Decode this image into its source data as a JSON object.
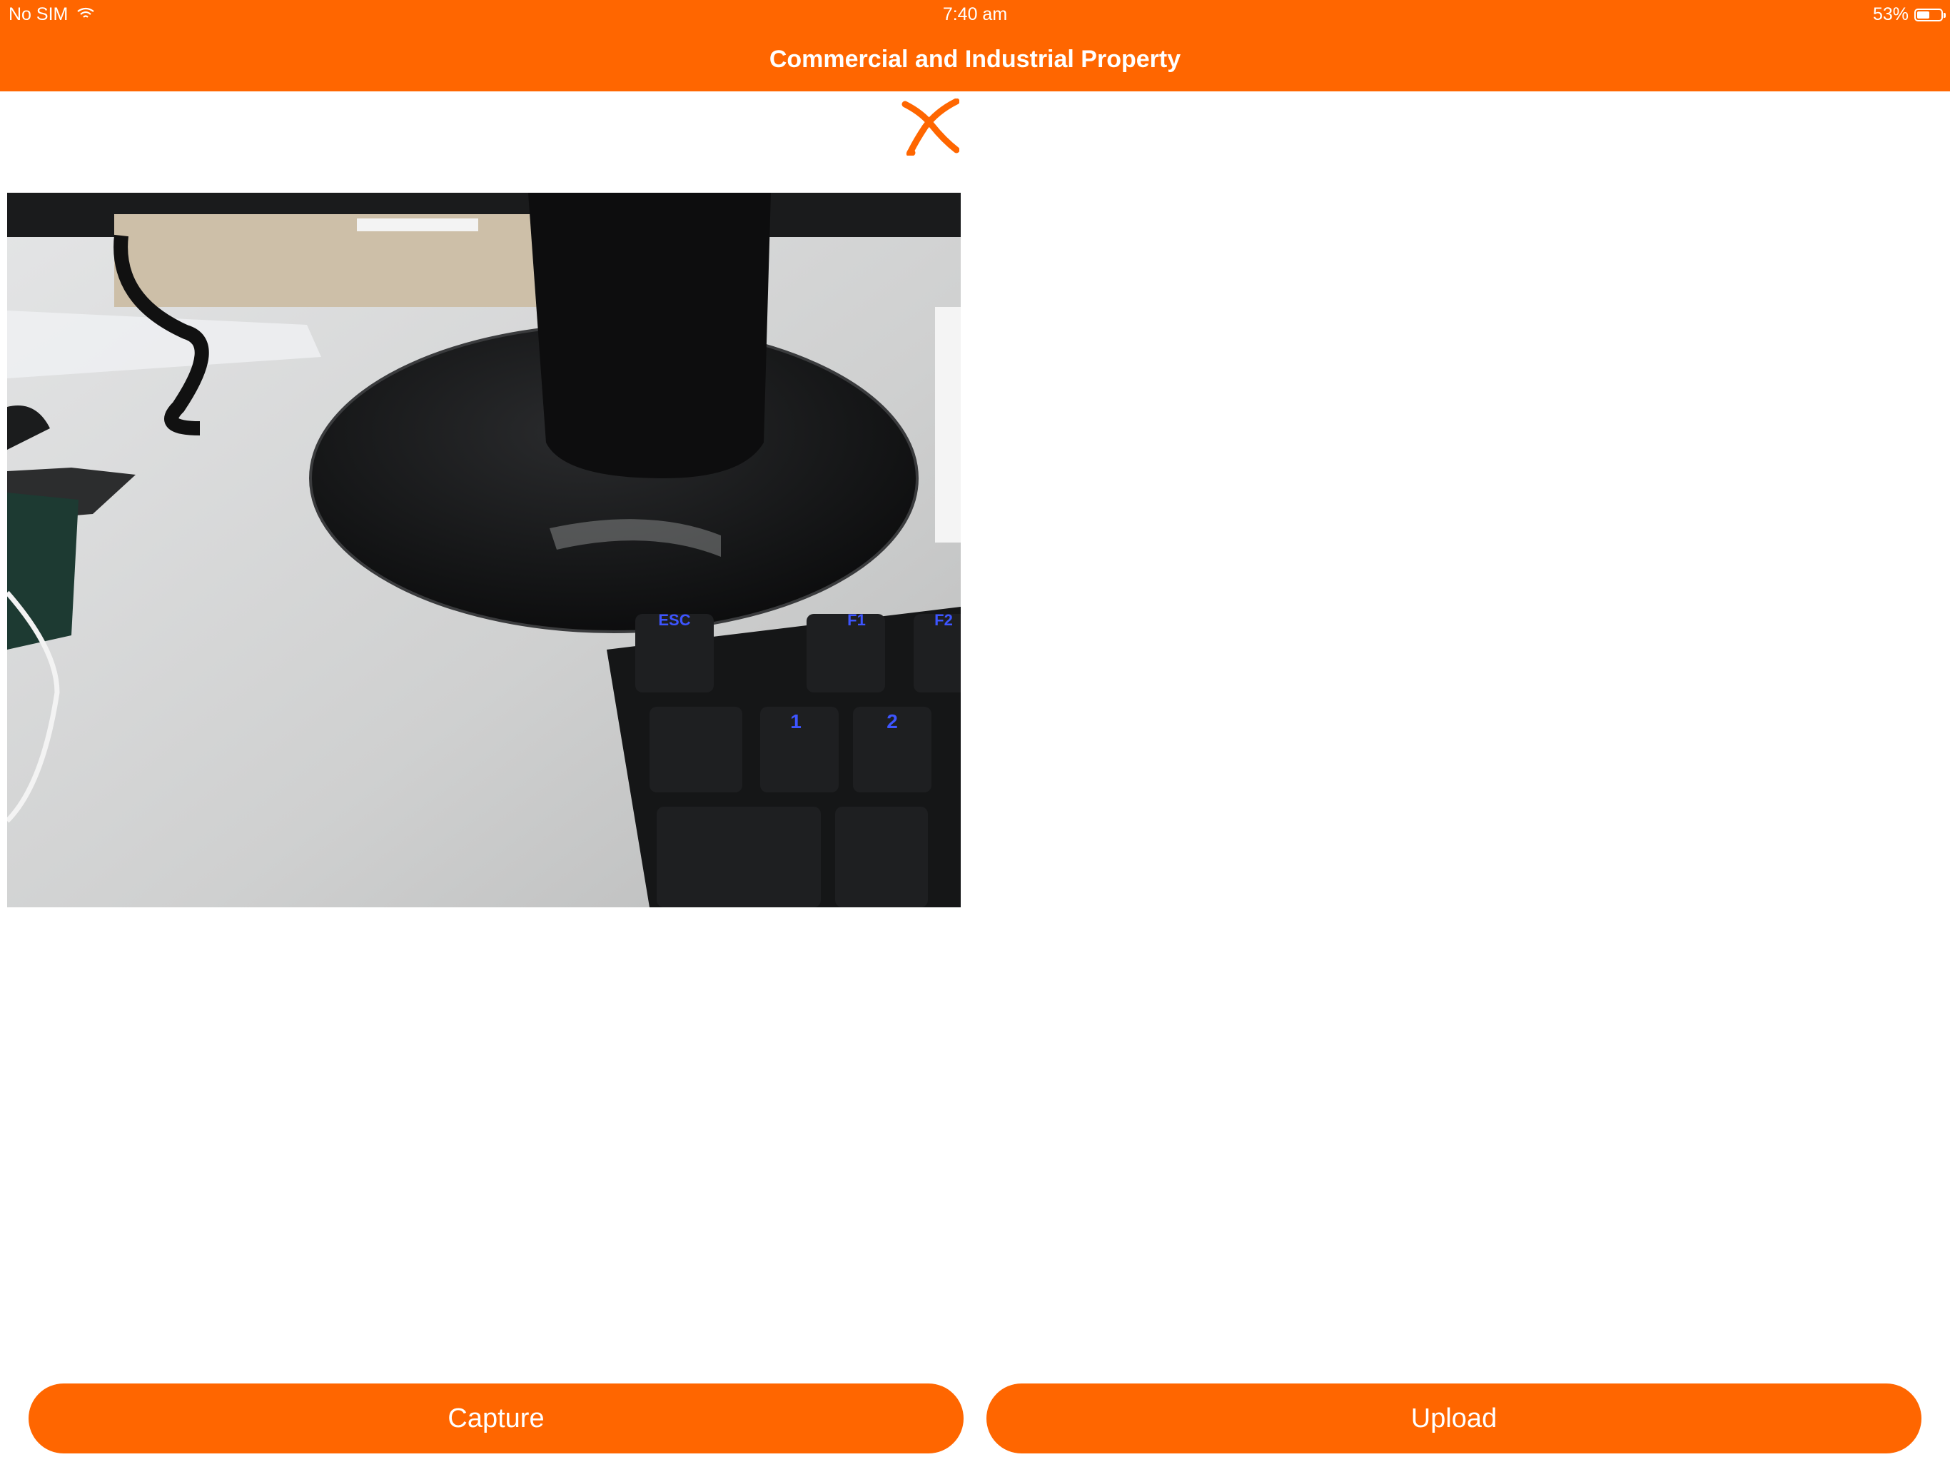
{
  "status_bar": {
    "carrier": "No SIM",
    "time": "7:40 am",
    "battery_percent_label": "53%",
    "battery_level": 0.53
  },
  "nav": {
    "title": "Commercial and Industrial Property"
  },
  "photo": {
    "keycaps": [
      "ESC",
      "F1",
      "F2",
      "1",
      "2"
    ]
  },
  "actions": {
    "capture_label": "Capture",
    "upload_label": "Upload"
  },
  "colors": {
    "brand": "#ff6600",
    "background": "#ffffff",
    "text_on_brand": "#ffffff"
  }
}
